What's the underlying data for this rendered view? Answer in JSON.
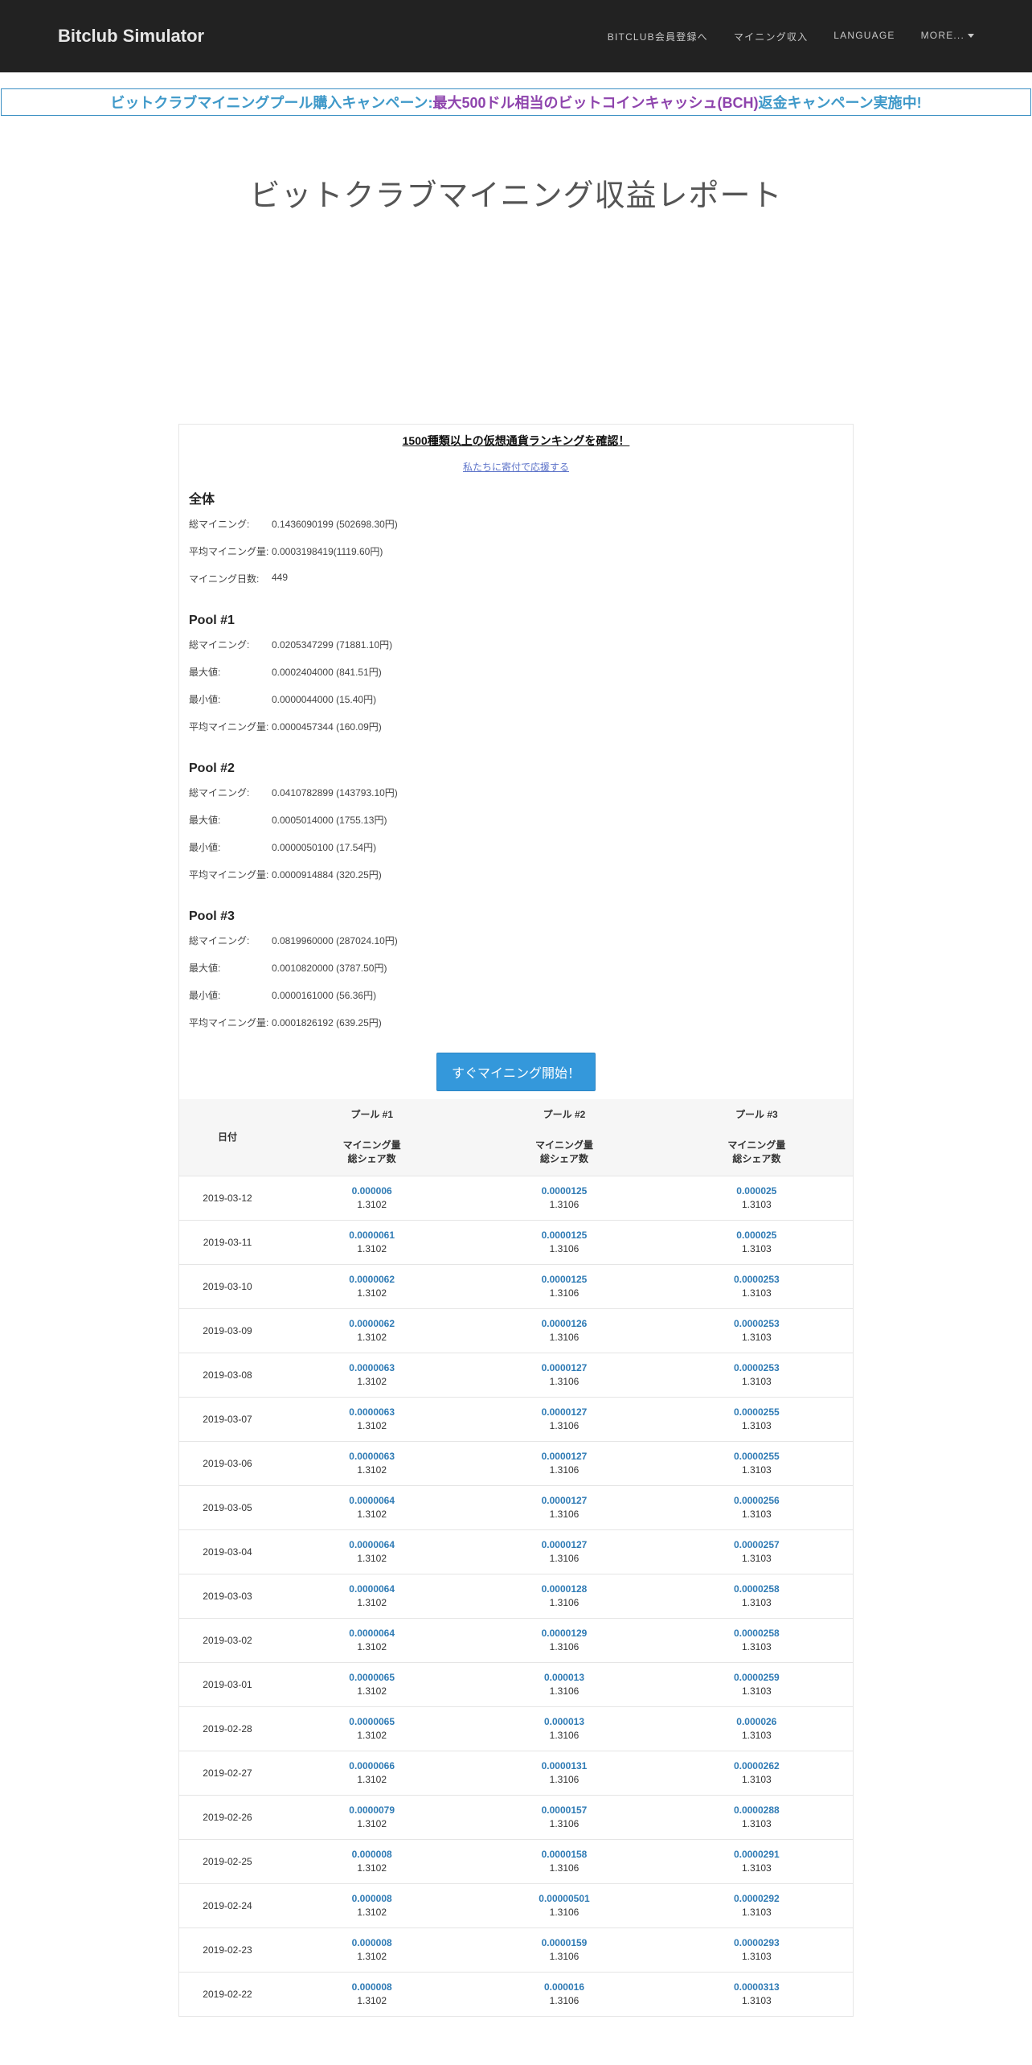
{
  "navbar": {
    "brand": "Bitclub Simulator",
    "links": [
      "BITCLUB会員登録へ",
      "マイニング収入",
      "LANGUAGE",
      "MORE..."
    ]
  },
  "banner": {
    "part1": "ビットクラブマイニングプール購入キャンペーン:",
    "part2": "最大500ドル相当のビットコインキャッシュ(BCH)",
    "part3": "返金キャンペーン実施中!"
  },
  "page_title": "ビットクラブマイニング収益レポート",
  "ranking_link": "1500種類以上の仮想通貨ランキングを確認！",
  "donate_link": "私たちに寄付で応援する",
  "summary": {
    "title": "全体",
    "rows": [
      {
        "label": "総マイニング:",
        "value": "0.1436090199 (502698.30円)"
      },
      {
        "label": "平均マイニング量:",
        "value": "0.0003198419(1119.60円)"
      },
      {
        "label": "マイニング日数:",
        "value": "449"
      }
    ]
  },
  "pools": [
    {
      "title": "Pool #1",
      "rows": [
        {
          "label": "総マイニング:",
          "value": "0.0205347299 (71881.10円)"
        },
        {
          "label": "最大値:",
          "value": "0.0002404000 (841.51円)"
        },
        {
          "label": "最小値:",
          "value": "0.0000044000 (15.40円)"
        },
        {
          "label": "平均マイニング量:",
          "value": "0.0000457344 (160.09円)"
        }
      ]
    },
    {
      "title": "Pool #2",
      "rows": [
        {
          "label": "総マイニング:",
          "value": "0.0410782899 (143793.10円)"
        },
        {
          "label": "最大値:",
          "value": "0.0005014000 (1755.13円)"
        },
        {
          "label": "最小値:",
          "value": "0.0000050100 (17.54円)"
        },
        {
          "label": "平均マイニング量:",
          "value": "0.0000914884 (320.25円)"
        }
      ]
    },
    {
      "title": "Pool #3",
      "rows": [
        {
          "label": "総マイニング:",
          "value": "0.0819960000 (287024.10円)"
        },
        {
          "label": "最大値:",
          "value": "0.0010820000 (3787.50円)"
        },
        {
          "label": "最小値:",
          "value": "0.0000161000 (56.36円)"
        },
        {
          "label": "平均マイニング量:",
          "value": "0.0001826192 (639.25円)"
        }
      ]
    }
  ],
  "start_button": "すぐマイニング開始！",
  "table": {
    "date_header": "日付",
    "pool_headers": [
      "プール #1",
      "プール #2",
      "プール #3"
    ],
    "sub_header_amount": "マイニング量",
    "sub_header_shares": "総シェア数",
    "rows": [
      {
        "date": "2019-03-12",
        "p1": "0.000006",
        "s1": "1.3102",
        "p2": "0.0000125",
        "s2": "1.3106",
        "p3": "0.000025",
        "s3": "1.3103"
      },
      {
        "date": "2019-03-11",
        "p1": "0.0000061",
        "s1": "1.3102",
        "p2": "0.0000125",
        "s2": "1.3106",
        "p3": "0.000025",
        "s3": "1.3103"
      },
      {
        "date": "2019-03-10",
        "p1": "0.0000062",
        "s1": "1.3102",
        "p2": "0.0000125",
        "s2": "1.3106",
        "p3": "0.0000253",
        "s3": "1.3103"
      },
      {
        "date": "2019-03-09",
        "p1": "0.0000062",
        "s1": "1.3102",
        "p2": "0.0000126",
        "s2": "1.3106",
        "p3": "0.0000253",
        "s3": "1.3103"
      },
      {
        "date": "2019-03-08",
        "p1": "0.0000063",
        "s1": "1.3102",
        "p2": "0.0000127",
        "s2": "1.3106",
        "p3": "0.0000253",
        "s3": "1.3103"
      },
      {
        "date": "2019-03-07",
        "p1": "0.0000063",
        "s1": "1.3102",
        "p2": "0.0000127",
        "s2": "1.3106",
        "p3": "0.0000255",
        "s3": "1.3103"
      },
      {
        "date": "2019-03-06",
        "p1": "0.0000063",
        "s1": "1.3102",
        "p2": "0.0000127",
        "s2": "1.3106",
        "p3": "0.0000255",
        "s3": "1.3103"
      },
      {
        "date": "2019-03-05",
        "p1": "0.0000064",
        "s1": "1.3102",
        "p2": "0.0000127",
        "s2": "1.3106",
        "p3": "0.0000256",
        "s3": "1.3103"
      },
      {
        "date": "2019-03-04",
        "p1": "0.0000064",
        "s1": "1.3102",
        "p2": "0.0000127",
        "s2": "1.3106",
        "p3": "0.0000257",
        "s3": "1.3103"
      },
      {
        "date": "2019-03-03",
        "p1": "0.0000064",
        "s1": "1.3102",
        "p2": "0.0000128",
        "s2": "1.3106",
        "p3": "0.0000258",
        "s3": "1.3103"
      },
      {
        "date": "2019-03-02",
        "p1": "0.0000064",
        "s1": "1.3102",
        "p2": "0.0000129",
        "s2": "1.3106",
        "p3": "0.0000258",
        "s3": "1.3103"
      },
      {
        "date": "2019-03-01",
        "p1": "0.0000065",
        "s1": "1.3102",
        "p2": "0.000013",
        "s2": "1.3106",
        "p3": "0.0000259",
        "s3": "1.3103"
      },
      {
        "date": "2019-02-28",
        "p1": "0.0000065",
        "s1": "1.3102",
        "p2": "0.000013",
        "s2": "1.3106",
        "p3": "0.000026",
        "s3": "1.3103"
      },
      {
        "date": "2019-02-27",
        "p1": "0.0000066",
        "s1": "1.3102",
        "p2": "0.0000131",
        "s2": "1.3106",
        "p3": "0.0000262",
        "s3": "1.3103"
      },
      {
        "date": "2019-02-26",
        "p1": "0.0000079",
        "s1": "1.3102",
        "p2": "0.0000157",
        "s2": "1.3106",
        "p3": "0.0000288",
        "s3": "1.3103"
      },
      {
        "date": "2019-02-25",
        "p1": "0.000008",
        "s1": "1.3102",
        "p2": "0.0000158",
        "s2": "1.3106",
        "p3": "0.0000291",
        "s3": "1.3103"
      },
      {
        "date": "2019-02-24",
        "p1": "0.000008",
        "s1": "1.3102",
        "p2": "0.00000501",
        "s2": "1.3106",
        "p3": "0.0000292",
        "s3": "1.3103"
      },
      {
        "date": "2019-02-23",
        "p1": "0.000008",
        "s1": "1.3102",
        "p2": "0.0000159",
        "s2": "1.3106",
        "p3": "0.0000293",
        "s3": "1.3103"
      },
      {
        "date": "2019-02-22",
        "p1": "0.000008",
        "s1": "1.3102",
        "p2": "0.000016",
        "s2": "1.3106",
        "p3": "0.0000313",
        "s3": "1.3103"
      }
    ]
  }
}
